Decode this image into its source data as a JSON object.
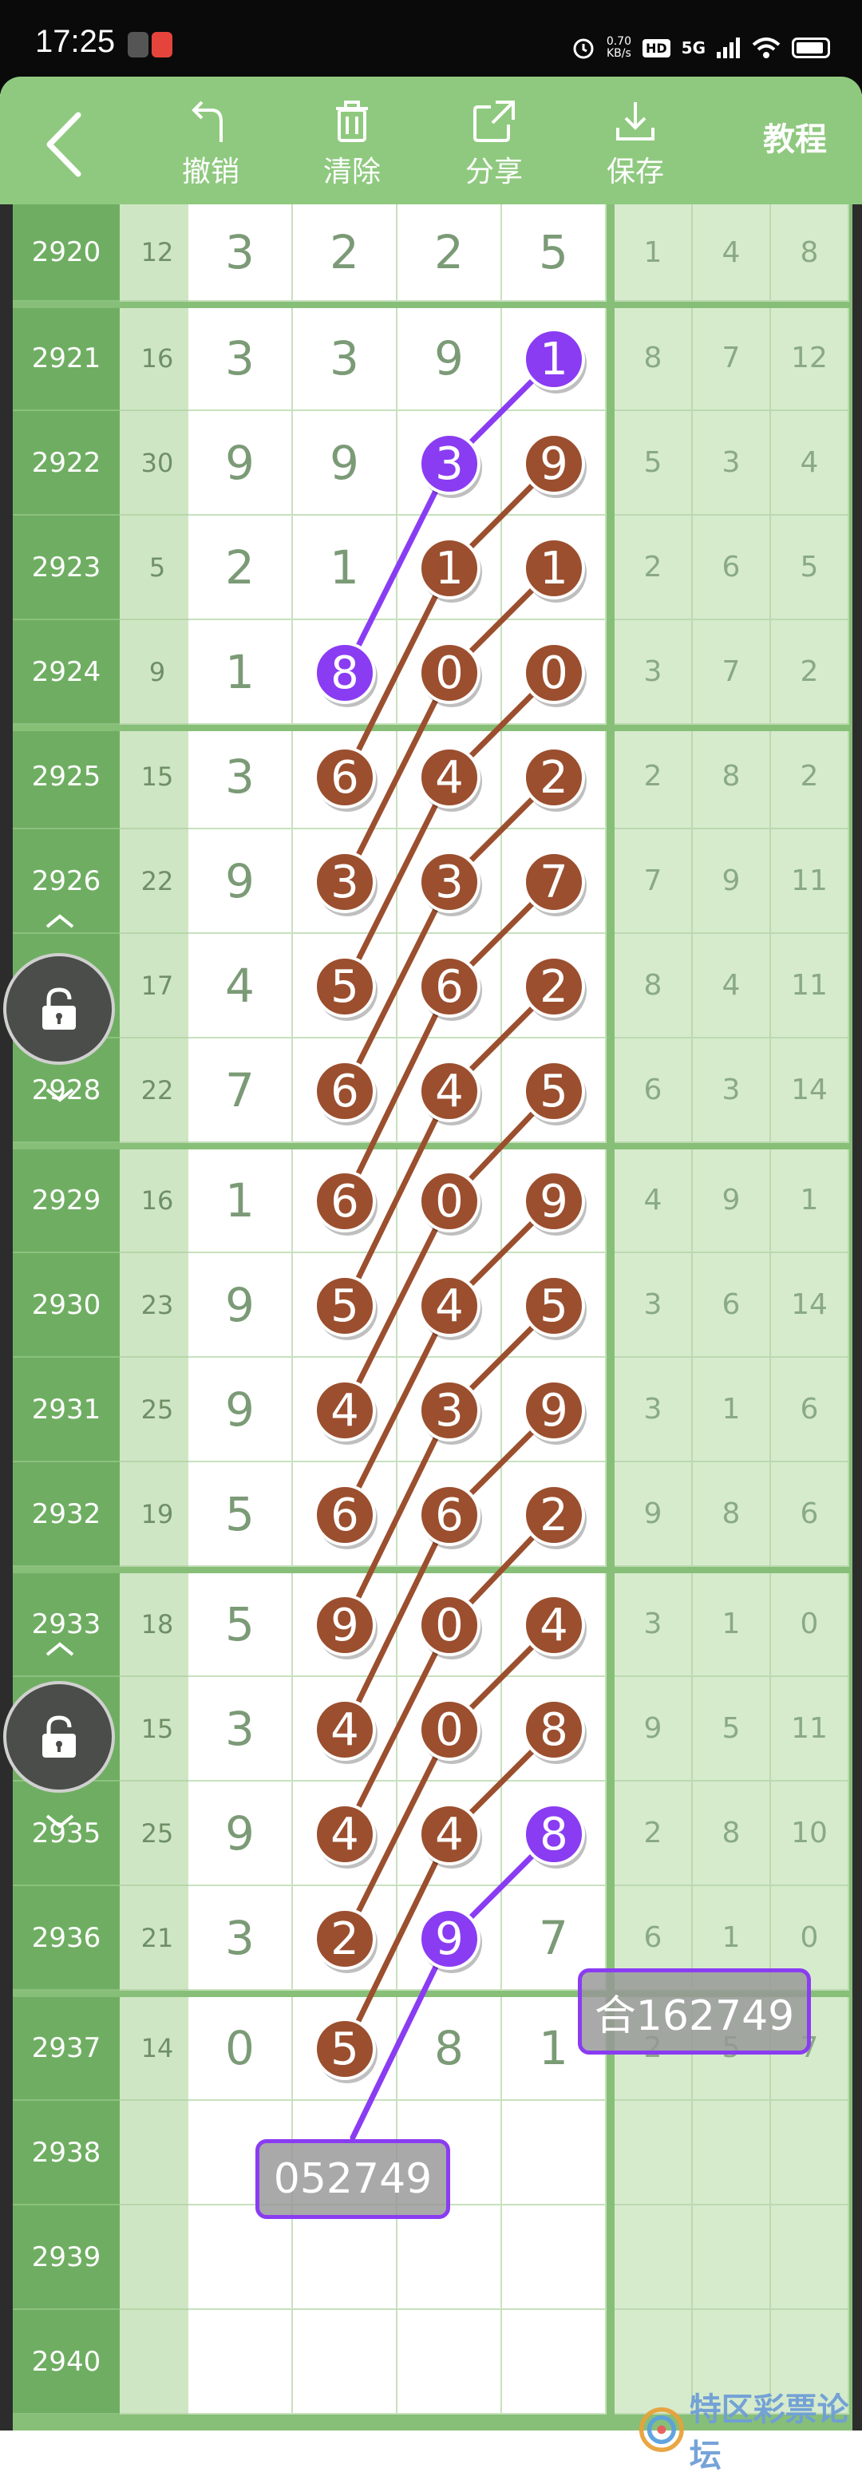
{
  "status_bar": {
    "time": "17:25",
    "net_speed": "0.70",
    "net_unit": "KB/s",
    "hd": "HD",
    "network": "5G"
  },
  "toolbar": {
    "back_icon": "chevron-left-icon",
    "undo_label": "撤销",
    "clear_label": "清除",
    "share_label": "分享",
    "save_label": "保存",
    "tutorial_label": "教程"
  },
  "colors": {
    "toolbar": "#8fc97f",
    "ball_brown": "#9b4f2e",
    "ball_purple": "#8a3cf2",
    "issue_col": "#6fae62"
  },
  "rows": [
    {
      "issue": "2920",
      "sum": "12",
      "digits": [
        "3",
        "2",
        "2",
        "5"
      ],
      "right": [
        "1",
        "4",
        "8"
      ]
    },
    {
      "issue": "2921",
      "sum": "16",
      "digits": [
        "3",
        "3",
        "9",
        "1"
      ],
      "right": [
        "8",
        "7",
        "12"
      ]
    },
    {
      "issue": "2922",
      "sum": "30",
      "digits": [
        "9",
        "9",
        "3",
        "9"
      ],
      "right": [
        "5",
        "3",
        "4"
      ]
    },
    {
      "issue": "2923",
      "sum": "5",
      "digits": [
        "2",
        "1",
        "1",
        "1"
      ],
      "right": [
        "2",
        "6",
        "5"
      ]
    },
    {
      "issue": "2924",
      "sum": "9",
      "digits": [
        "1",
        "8",
        "0",
        "0"
      ],
      "right": [
        "3",
        "7",
        "2"
      ]
    },
    {
      "issue": "2925",
      "sum": "15",
      "digits": [
        "3",
        "6",
        "4",
        "2"
      ],
      "right": [
        "2",
        "8",
        "2"
      ]
    },
    {
      "issue": "2926",
      "sum": "22",
      "digits": [
        "9",
        "3",
        "3",
        "7"
      ],
      "right": [
        "7",
        "9",
        "11"
      ]
    },
    {
      "issue": "2927",
      "sum": "17",
      "digits": [
        "4",
        "5",
        "6",
        "2"
      ],
      "right": [
        "8",
        "4",
        "11"
      ]
    },
    {
      "issue": "2928",
      "sum": "22",
      "digits": [
        "7",
        "6",
        "4",
        "5"
      ],
      "right": [
        "6",
        "3",
        "14"
      ]
    },
    {
      "issue": "2929",
      "sum": "16",
      "digits": [
        "1",
        "6",
        "0",
        "9"
      ],
      "right": [
        "4",
        "9",
        "1"
      ]
    },
    {
      "issue": "2930",
      "sum": "23",
      "digits": [
        "9",
        "5",
        "4",
        "5"
      ],
      "right": [
        "3",
        "6",
        "14"
      ]
    },
    {
      "issue": "2931",
      "sum": "25",
      "digits": [
        "9",
        "4",
        "3",
        "9"
      ],
      "right": [
        "3",
        "1",
        "6"
      ]
    },
    {
      "issue": "2932",
      "sum": "19",
      "digits": [
        "5",
        "6",
        "6",
        "2"
      ],
      "right": [
        "9",
        "8",
        "6"
      ]
    },
    {
      "issue": "2933",
      "sum": "18",
      "digits": [
        "5",
        "9",
        "0",
        "4"
      ],
      "right": [
        "3",
        "1",
        "0"
      ]
    },
    {
      "issue": "2934",
      "sum": "15",
      "digits": [
        "3",
        "4",
        "0",
        "8"
      ],
      "right": [
        "9",
        "5",
        "11"
      ]
    },
    {
      "issue": "2935",
      "sum": "25",
      "digits": [
        "9",
        "4",
        "4",
        "8"
      ],
      "right": [
        "2",
        "8",
        "10"
      ]
    },
    {
      "issue": "2936",
      "sum": "21",
      "digits": [
        "3",
        "2",
        "9",
        "7"
      ],
      "right": [
        "6",
        "1",
        "0"
      ]
    },
    {
      "issue": "2937",
      "sum": "14",
      "digits": [
        "0",
        "5",
        "8",
        "1"
      ],
      "right": [
        "2",
        "5",
        "7"
      ]
    },
    {
      "issue": "2938",
      "sum": "",
      "digits": [
        "",
        "",
        "",
        ""
      ],
      "right": [
        "",
        "",
        ""
      ]
    },
    {
      "issue": "2939",
      "sum": "",
      "digits": [
        "",
        "",
        "",
        ""
      ],
      "right": [
        "",
        "",
        ""
      ]
    },
    {
      "issue": "2940",
      "sum": "",
      "digits": [
        "",
        "",
        "",
        ""
      ],
      "right": [
        "",
        "",
        ""
      ]
    }
  ],
  "balls": [
    {
      "row": 1,
      "col": 3,
      "digit": "1",
      "color": "purple"
    },
    {
      "row": 2,
      "col": 2,
      "digit": "3",
      "color": "purple"
    },
    {
      "row": 4,
      "col": 1,
      "digit": "8",
      "color": "purple"
    },
    {
      "row": 2,
      "col": 3,
      "digit": "9",
      "color": "brown"
    },
    {
      "row": 3,
      "col": 2,
      "digit": "1",
      "color": "brown"
    },
    {
      "row": 3,
      "col": 3,
      "digit": "1",
      "color": "brown"
    },
    {
      "row": 4,
      "col": 2,
      "digit": "0",
      "color": "brown"
    },
    {
      "row": 4,
      "col": 3,
      "digit": "0",
      "color": "brown"
    },
    {
      "row": 5,
      "col": 1,
      "digit": "6",
      "color": "brown"
    },
    {
      "row": 5,
      "col": 2,
      "digit": "4",
      "color": "brown"
    },
    {
      "row": 5,
      "col": 3,
      "digit": "2",
      "color": "brown"
    },
    {
      "row": 6,
      "col": 1,
      "digit": "3",
      "color": "brown"
    },
    {
      "row": 6,
      "col": 2,
      "digit": "3",
      "color": "brown"
    },
    {
      "row": 6,
      "col": 3,
      "digit": "7",
      "color": "brown"
    },
    {
      "row": 7,
      "col": 1,
      "digit": "5",
      "color": "brown"
    },
    {
      "row": 7,
      "col": 2,
      "digit": "6",
      "color": "brown"
    },
    {
      "row": 7,
      "col": 3,
      "digit": "2",
      "color": "brown"
    },
    {
      "row": 8,
      "col": 1,
      "digit": "6",
      "color": "brown"
    },
    {
      "row": 8,
      "col": 2,
      "digit": "4",
      "color": "brown"
    },
    {
      "row": 8,
      "col": 3,
      "digit": "5",
      "color": "brown"
    },
    {
      "row": 9,
      "col": 1,
      "digit": "6",
      "color": "brown"
    },
    {
      "row": 9,
      "col": 2,
      "digit": "0",
      "color": "brown"
    },
    {
      "row": 9,
      "col": 3,
      "digit": "9",
      "color": "brown"
    },
    {
      "row": 10,
      "col": 1,
      "digit": "5",
      "color": "brown"
    },
    {
      "row": 10,
      "col": 2,
      "digit": "4",
      "color": "brown"
    },
    {
      "row": 10,
      "col": 3,
      "digit": "5",
      "color": "brown"
    },
    {
      "row": 11,
      "col": 1,
      "digit": "4",
      "color": "brown"
    },
    {
      "row": 11,
      "col": 2,
      "digit": "3",
      "color": "brown"
    },
    {
      "row": 11,
      "col": 3,
      "digit": "9",
      "color": "brown"
    },
    {
      "row": 12,
      "col": 1,
      "digit": "6",
      "color": "brown"
    },
    {
      "row": 12,
      "col": 2,
      "digit": "6",
      "color": "brown"
    },
    {
      "row": 12,
      "col": 3,
      "digit": "2",
      "color": "brown"
    },
    {
      "row": 13,
      "col": 1,
      "digit": "9",
      "color": "brown"
    },
    {
      "row": 13,
      "col": 2,
      "digit": "0",
      "color": "brown"
    },
    {
      "row": 13,
      "col": 3,
      "digit": "4",
      "color": "brown"
    },
    {
      "row": 14,
      "col": 1,
      "digit": "4",
      "color": "brown"
    },
    {
      "row": 14,
      "col": 2,
      "digit": "0",
      "color": "brown"
    },
    {
      "row": 14,
      "col": 3,
      "digit": "8",
      "color": "brown"
    },
    {
      "row": 15,
      "col": 1,
      "digit": "4",
      "color": "brown"
    },
    {
      "row": 15,
      "col": 2,
      "digit": "4",
      "color": "brown"
    },
    {
      "row": 15,
      "col": 3,
      "digit": "8",
      "color": "purple"
    },
    {
      "row": 16,
      "col": 1,
      "digit": "2",
      "color": "brown"
    },
    {
      "row": 16,
      "col": 2,
      "digit": "9",
      "color": "purple"
    },
    {
      "row": 17,
      "col": 1,
      "digit": "5",
      "color": "brown"
    }
  ],
  "tags": {
    "prediction": "052749",
    "combined": "合162749"
  },
  "watermark": "特区彩票论坛"
}
